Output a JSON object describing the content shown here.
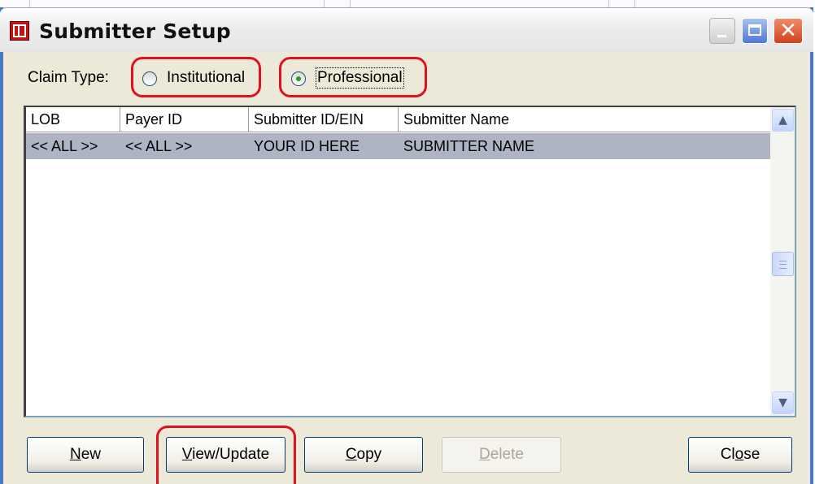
{
  "window": {
    "title": "Submitter Setup",
    "close_glyph": "✕"
  },
  "claim_type": {
    "label": "Claim Type:",
    "options": [
      {
        "label": "Institutional",
        "selected": false
      },
      {
        "label": "Professional",
        "selected": true
      }
    ]
  },
  "table": {
    "columns": [
      "LOB",
      "Payer ID",
      "Submitter ID/EIN",
      "Submitter Name"
    ],
    "rows": [
      [
        "<< ALL >>",
        "<< ALL >>",
        "YOUR ID HERE",
        "SUBMITTER NAME"
      ]
    ]
  },
  "buttons": {
    "new": {
      "mnemonic": "N",
      "rest": "ew"
    },
    "view_update": {
      "mnemonic": "V",
      "rest": "iew/Update"
    },
    "copy": {
      "mnemonic": "C",
      "rest": "opy"
    },
    "delete": {
      "mnemonic": "D",
      "rest": "elete"
    },
    "close": {
      "pre": "Cl",
      "mnemonic": "o",
      "rest": "se"
    }
  },
  "colors": {
    "annotation": "#e01020",
    "selected_row": "#aeb4c4",
    "window_face": "#ece9d8"
  }
}
